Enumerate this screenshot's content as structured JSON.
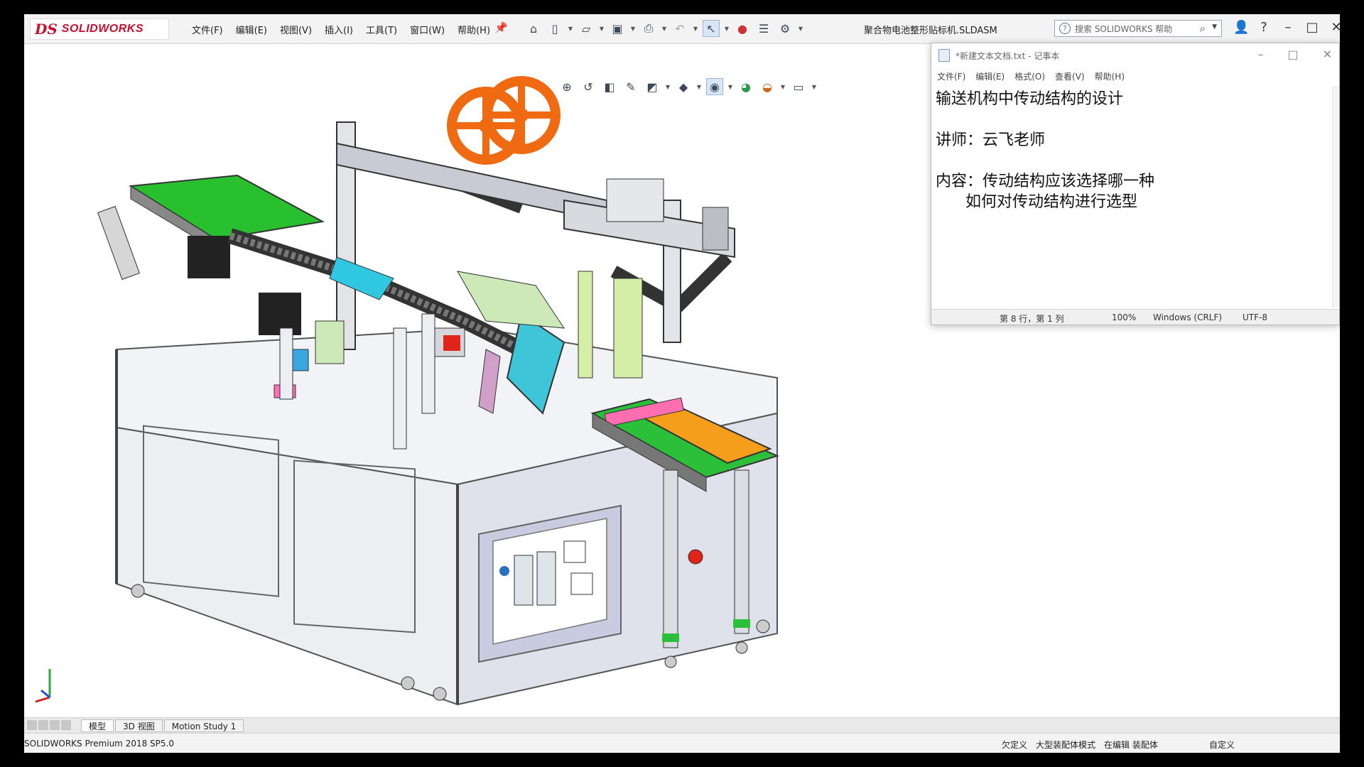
{
  "app": {
    "logo_mark": "DS",
    "logo_name": "SOLIDWORKS",
    "menu": [
      "文件(F)",
      "编辑(E)",
      "视图(V)",
      "插入(I)",
      "工具(T)",
      "窗口(W)",
      "帮助(H)"
    ],
    "document_title": "聚合物电池整形贴标机.SLDASM",
    "search_placeholder": "搜索 SOLIDWORKS 帮助",
    "toolbar_icons": [
      "home-icon",
      "new-file-icon",
      "open-file-icon",
      "save-icon",
      "print-icon",
      "undo-icon",
      "select-icon",
      "traffic-light-icon",
      "file-properties-icon",
      "options-icon"
    ],
    "view_icons": [
      "zoom-to-fit-icon",
      "zoom-area-icon",
      "previous-view-icon",
      "section-view-icon",
      "dynamic-annotation-icon",
      "view-orientation-icon",
      "display-style-icon",
      "hide-show-icon",
      "edit-appearance-icon",
      "apply-scene-icon",
      "view-settings-icon"
    ]
  },
  "notepad": {
    "title": "*新建文本文档.txt - 记事本",
    "menu": [
      "文件(F)",
      "编辑(E)",
      "格式(O)",
      "查看(V)",
      "帮助(H)"
    ],
    "body": "输送机构中传动结构的设计\n\n讲师：云飞老师\n\n内容：传动结构应该选择哪一种\n      如何对传动结构进行选型",
    "status": {
      "position": "第 8 行，第 1 列",
      "zoom": "100%",
      "line_ending": "Windows (CRLF)",
      "encoding": "UTF-8"
    }
  },
  "tabs": [
    "模型",
    "3D 视图",
    "Motion Study 1"
  ],
  "statusbar": {
    "product": "SOLIDWORKS Premium 2018 SP5.0",
    "items": [
      "欠定义",
      "大型装配体模式",
      "在编辑 装配体",
      "自定义"
    ]
  }
}
